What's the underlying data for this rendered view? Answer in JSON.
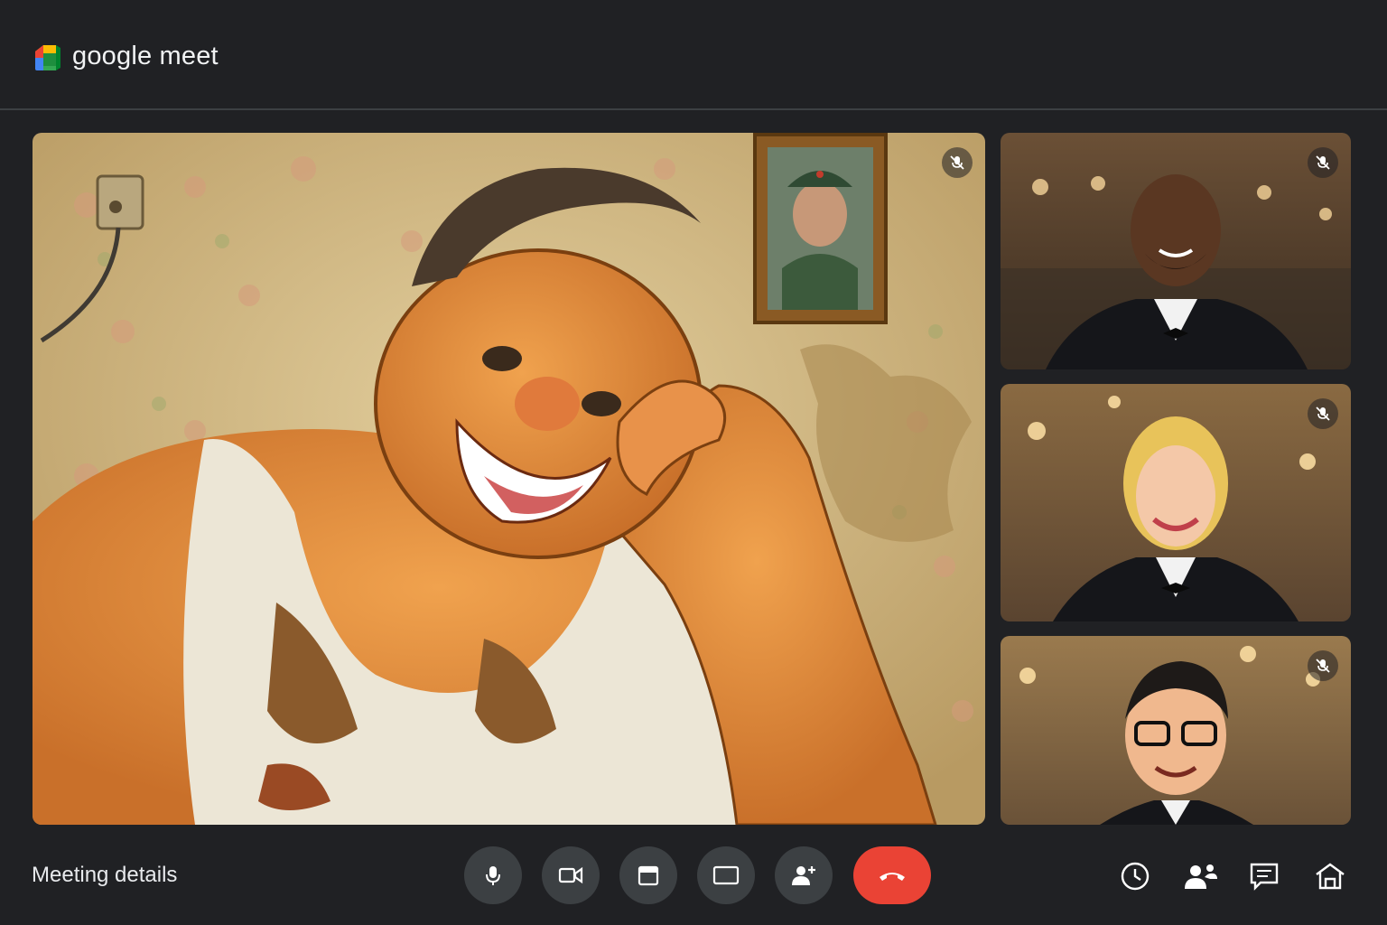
{
  "app": {
    "title": "google meet",
    "logo": "google-meet-logo"
  },
  "participants": [
    {
      "tile": "main",
      "status_icon": "mic-off-icon",
      "scene": "cartoon man in torn tank top, floral wallpaper, framed portrait of a soldier"
    },
    {
      "tile": "side-1",
      "status_icon": "mic-off-icon",
      "scene": "man in tuxedo in banquet hall"
    },
    {
      "tile": "side-2",
      "status_icon": "mic-off-icon",
      "scene": "blonde woman in tuxedo in banquet hall"
    },
    {
      "tile": "side-3",
      "status_icon": "mic-off-icon",
      "scene": "man with glasses in banquet hall"
    }
  ],
  "footer": {
    "meeting_details_label": "Meeting details"
  },
  "controls": [
    {
      "name": "microphone",
      "icon": "mic-icon"
    },
    {
      "name": "camera",
      "icon": "camera-icon"
    },
    {
      "name": "captions",
      "icon": "captions-icon"
    },
    {
      "name": "present",
      "icon": "present-icon"
    },
    {
      "name": "add-people",
      "icon": "add-person-icon"
    },
    {
      "name": "end-call",
      "icon": "phone-hangup-icon",
      "color": "#ea4335"
    }
  ],
  "tools": [
    {
      "name": "clock",
      "icon": "clock-icon"
    },
    {
      "name": "people",
      "icon": "people-icon"
    },
    {
      "name": "chat",
      "icon": "chat-icon"
    },
    {
      "name": "activities",
      "icon": "home-icon"
    }
  ],
  "colors": {
    "background": "#202124",
    "control": "#3c4043",
    "end_call": "#ea4335",
    "text": "#e8eaed"
  }
}
